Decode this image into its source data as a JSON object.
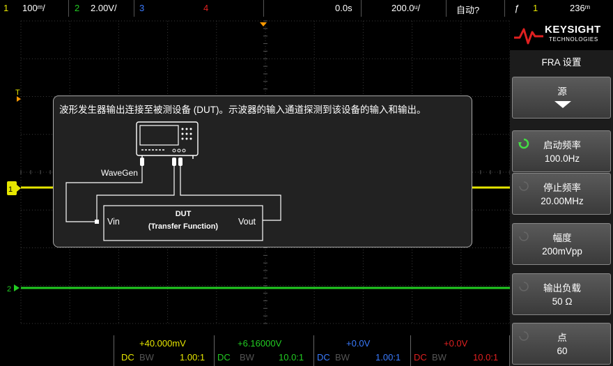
{
  "topbar": {
    "ch1_num": "1",
    "ch1_scale": "100ᵐ/",
    "ch2_num": "2",
    "ch2_scale": "2.00V/",
    "ch3_num": "3",
    "ch4_num": "4",
    "time_delay": "0.0s",
    "time_scale": "200.0ᵘ/",
    "trigger_mode": "自动?",
    "trigger_slope": "ƒ",
    "trigger_src": "1",
    "trigger_level": "236ᵐ"
  },
  "dialog": {
    "text": "波形发生器输出连接至被测设备 (DUT)。示波器的输入通道探测到该设备的输入和输出。",
    "wavegen_label": "WaveGen",
    "vin_label": "Vin",
    "vout_label": "Vout",
    "dut_title": "DUT",
    "dut_sub": "(Transfer Function)"
  },
  "panel": {
    "logo_word": "KEYSIGHT",
    "logo_sub": "TECHNOLOGIES",
    "title": "FRA 设置",
    "keys": [
      {
        "label": "源",
        "value": ""
      },
      {
        "label": "启动频率",
        "value": "100.0Hz"
      },
      {
        "label": "停止频率",
        "value": "20.00MHz"
      },
      {
        "label": "幅度",
        "value": "200mVpp"
      },
      {
        "label": "输出负载",
        "value": "50 Ω"
      },
      {
        "label": "点",
        "value": "60"
      }
    ]
  },
  "bottombar": {
    "ch1_offset": "+40.000mV",
    "ch2_offset": "+6.16000V",
    "ch3_offset": "+0.0V",
    "ch4_offset": "+0.0V",
    "coupling": "DC",
    "bw": "BW",
    "ch1_probe": "1.00:1",
    "ch2_probe": "10.0:1",
    "ch3_probe": "1.00:1",
    "ch4_probe": "10.0:1"
  },
  "colors": {
    "ch1": "#e6e600",
    "ch2": "#22cc22",
    "ch3": "#3a7bff",
    "ch4": "#e02020",
    "trigger_marker": "#ff9900"
  }
}
